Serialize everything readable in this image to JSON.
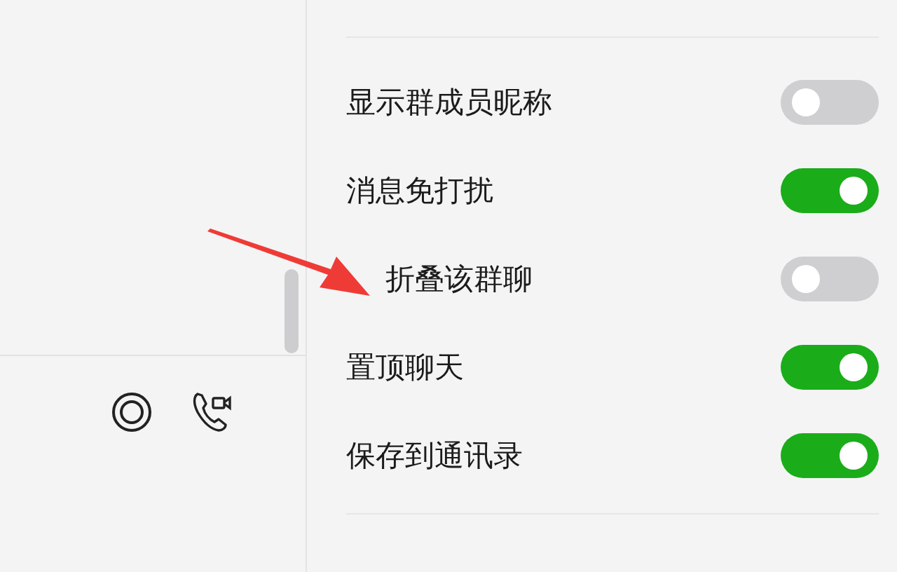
{
  "chat_panel": {
    "toolbar_icons": [
      {
        "kind": "circle"
      },
      {
        "kind": "video-call"
      }
    ]
  },
  "settings": [
    {
      "kind": "plain",
      "label": "显示群成员昵称",
      "on": false
    },
    {
      "kind": "plain",
      "label": "消息免打扰",
      "on": true
    },
    {
      "kind": "pointed",
      "label": "折叠该群聊",
      "on": false
    },
    {
      "kind": "plain",
      "label": "置顶聊天",
      "on": true
    },
    {
      "kind": "plain",
      "label": "保存到通讯录",
      "on": true
    }
  ]
}
